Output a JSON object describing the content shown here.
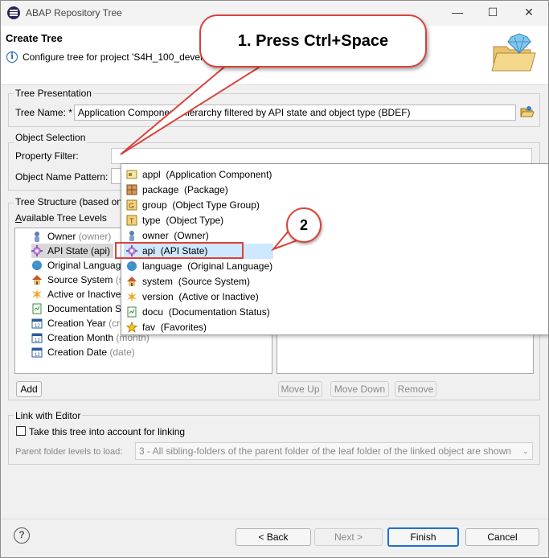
{
  "window": {
    "title": "ABAP Repository Tree",
    "minimize": "—",
    "maximize": "☐",
    "close": "✕"
  },
  "header": {
    "title": "Create Tree",
    "description": "Configure tree for project 'S4H_100_develo"
  },
  "tree_presentation": {
    "legend": "Tree Presentation",
    "name_label": "Tree Name: *",
    "name_value": "Application Component Hierarchy filtered by API state and object type (BDEF)"
  },
  "object_selection": {
    "legend": "Object Selection",
    "property_filter_label": "Property Filter:",
    "property_filter_value": "",
    "object_name_label": "Object Name Pattern:"
  },
  "tree_structure": {
    "legend": "Tree Structure (based on p",
    "available_label": "Available Tree Levels",
    "items": [
      {
        "label": "Owner",
        "hint": "(owner)",
        "icon": "person-icon"
      },
      {
        "label": "API State (api)",
        "hint": "",
        "icon": "gear-icon"
      },
      {
        "label": "Original Languag",
        "hint": "",
        "icon": "globe-icon"
      },
      {
        "label": "Source System",
        "hint": "(sy",
        "icon": "house-icon"
      },
      {
        "label": "Active or Inactive",
        "hint": "",
        "icon": "star-burst-icon"
      },
      {
        "label": "Documentation S",
        "hint": "",
        "icon": "doc-icon"
      },
      {
        "label": "Creation Year",
        "hint": "(cre",
        "icon": "calendar-icon"
      },
      {
        "label": "Creation Month",
        "hint": "(month)",
        "icon": "calendar-icon"
      },
      {
        "label": "Creation Date",
        "hint": "(date)",
        "icon": "calendar-icon"
      }
    ],
    "add_label": "Add",
    "move_up_label": "Move Up",
    "move_down_label": "Move Down",
    "remove_label": "Remove"
  },
  "link_with_editor": {
    "legend": "Link with Editor",
    "checkbox_label": "Take this tree into account for linking",
    "levels_label": "Parent folder levels to load:",
    "levels_value": "3 - All sibling-folders of the parent folder of the leaf folder of the linked object are shown"
  },
  "popup": {
    "items": [
      {
        "key": "appl",
        "desc": "(Application Component)",
        "icon": "component-icon"
      },
      {
        "key": "package",
        "desc": "(Package)",
        "icon": "package-icon"
      },
      {
        "key": "group",
        "desc": "(Object Type Group)",
        "icon": "group-icon"
      },
      {
        "key": "type",
        "desc": "(Object Type)",
        "icon": "type-icon"
      },
      {
        "key": "owner",
        "desc": "(Owner)",
        "icon": "person-icon"
      },
      {
        "key": "api",
        "desc": "(API State)",
        "icon": "gear-icon"
      },
      {
        "key": "language",
        "desc": "(Original Language)",
        "icon": "globe-icon"
      },
      {
        "key": "system",
        "desc": "(Source System)",
        "icon": "house-icon"
      },
      {
        "key": "version",
        "desc": "(Active or Inactive)",
        "icon": "star-burst-icon"
      },
      {
        "key": "docu",
        "desc": "(Documentation Status)",
        "icon": "doc-icon"
      },
      {
        "key": "fav",
        "desc": "(Favorites)",
        "icon": "star-icon"
      }
    ]
  },
  "callouts": {
    "step1": "1. Press Ctrl+Space",
    "step2": "2"
  },
  "footer": {
    "help": "?",
    "back": "< Back",
    "next": "Next >",
    "finish": "Finish",
    "cancel": "Cancel"
  },
  "colors": {
    "accent_red": "#d9423a",
    "selection": "#cde8ff",
    "finish_border": "#1e6fd1"
  }
}
